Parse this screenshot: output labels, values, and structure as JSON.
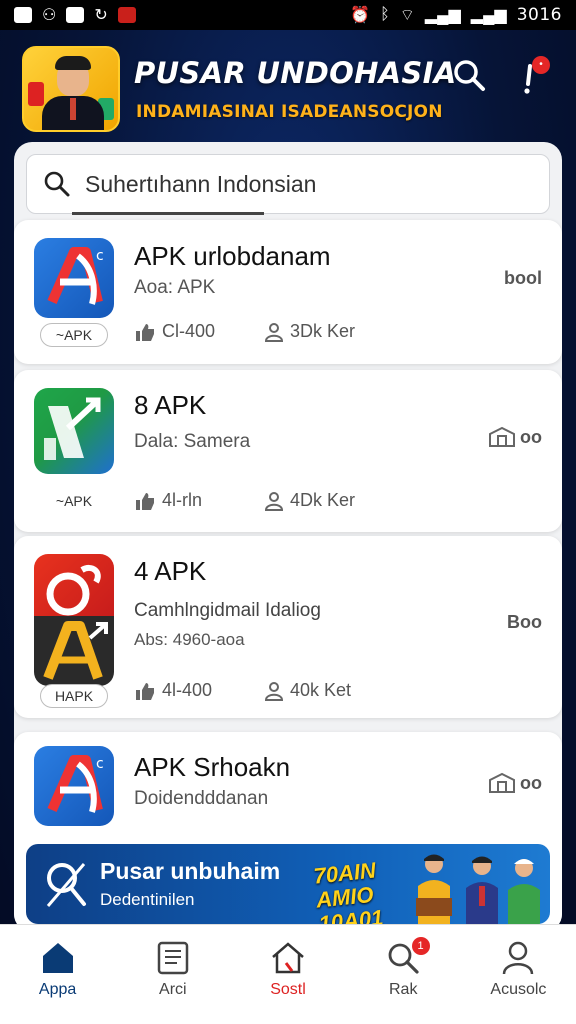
{
  "status_bar": {
    "time": "3016"
  },
  "header": {
    "title": "PUSAR UNDOHASIA",
    "subtitle": "INDAMIASINAI ISADEANSOCJON"
  },
  "search": {
    "value": "Suhertıhann Indonsian"
  },
  "cards": [
    {
      "title": "APK urlobdanam",
      "subtitle": "Aoa: APK",
      "icon_badge": "~APK",
      "stat1": "Cl-400",
      "stat2": "3Dk Ker",
      "action": "bool"
    },
    {
      "title": "8 APK",
      "subtitle": "Dala: Samera",
      "icon_badge": "~APK",
      "stat1": "4l-rln",
      "stat2": "4Dk Ker",
      "action": "oo"
    },
    {
      "title": "4 APK",
      "subtitle": "Camhlngidmail Idaliog",
      "subtitle2": "Abs: 4960-aoa",
      "icon_badge": "HAPK",
      "stat1": "4l-400",
      "stat2": "40k Ket",
      "action": "Boo"
    },
    {
      "title": "APK Srhoakn",
      "subtitle": "Doidendddanan",
      "action": "oo"
    }
  ],
  "banner": {
    "title": "Pusar unbuhaim",
    "subtitle": "Dedentinilen",
    "promo": "70AIN AMIO 10A01"
  },
  "nav": {
    "items": [
      {
        "label": "Appa"
      },
      {
        "label": "Arci"
      },
      {
        "label": "Sostl"
      },
      {
        "label": "Rak",
        "badge": "1"
      },
      {
        "label": "Acusolc"
      }
    ]
  },
  "colors": {
    "accent_navy": "#0a3b75",
    "promo_yellow": "#ffd21a",
    "subtitle_orange": "#ffb21a",
    "badge_red": "#e52727"
  }
}
